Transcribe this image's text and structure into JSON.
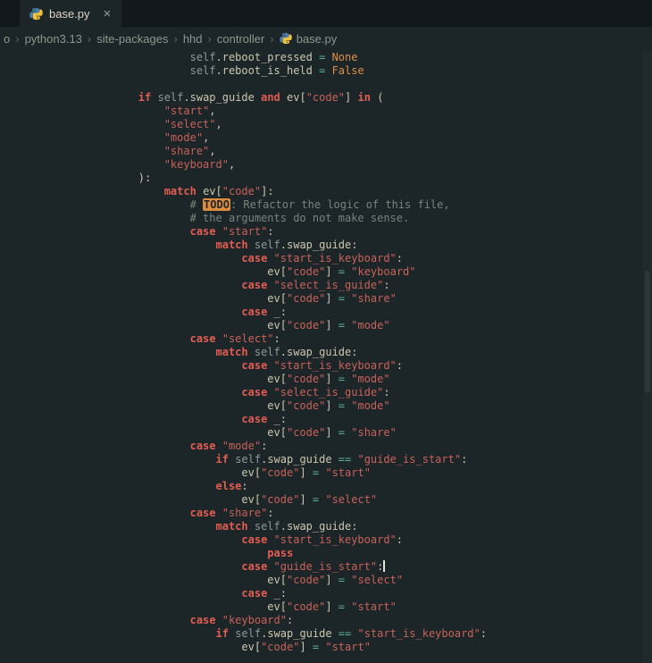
{
  "colors": {
    "bg": "#1c2527",
    "tabbar": "#12191c",
    "fg": "#ccc7af",
    "kw": "#e25d52",
    "str": "#c8625a",
    "op": "#5bb193",
    "cons": "#dd9046",
    "cmt": "#79837c",
    "slf": "#8b99a4",
    "todo_bg": "#de8d40",
    "todo_fg": "#1c2527",
    "bc": "#8d978f",
    "tab_fg": "#dcd6c6",
    "cursor": "#e0e4dd"
  },
  "tab": {
    "label": "base.py",
    "close_glyph": "×"
  },
  "breadcrumb": {
    "separator": "›",
    "items": [
      "o",
      "python3.13",
      "site-packages",
      "hhd",
      "controller",
      "base.py"
    ]
  },
  "editor": {
    "cursor_line": 38,
    "lines": [
      [
        [
          "v",
          "                "
        ],
        [
          "f",
          "self"
        ],
        [
          "v",
          ".reboot_pressed "
        ],
        [
          "o",
          "="
        ],
        [
          "v",
          " "
        ],
        [
          "c",
          "None"
        ]
      ],
      [
        [
          "v",
          "                "
        ],
        [
          "f",
          "self"
        ],
        [
          "v",
          ".reboot_is_held "
        ],
        [
          "o",
          "="
        ],
        [
          "v",
          " "
        ],
        [
          "c",
          "False"
        ]
      ],
      [],
      [
        [
          "v",
          "        "
        ],
        [
          "k",
          "if "
        ],
        [
          "f",
          "self"
        ],
        [
          "v",
          ".swap_guide "
        ],
        [
          "k",
          "and "
        ],
        [
          "v",
          "ev["
        ],
        [
          "s",
          "\"code\""
        ],
        [
          "v",
          "] "
        ],
        [
          "k",
          "in "
        ],
        [
          "v",
          "("
        ]
      ],
      [
        [
          "v",
          "            "
        ],
        [
          "s",
          "\"start\""
        ],
        [
          "v",
          ","
        ]
      ],
      [
        [
          "v",
          "            "
        ],
        [
          "s",
          "\"select\""
        ],
        [
          "v",
          ","
        ]
      ],
      [
        [
          "v",
          "            "
        ],
        [
          "s",
          "\"mode\""
        ],
        [
          "v",
          ","
        ]
      ],
      [
        [
          "v",
          "            "
        ],
        [
          "s",
          "\"share\""
        ],
        [
          "v",
          ","
        ]
      ],
      [
        [
          "v",
          "            "
        ],
        [
          "s",
          "\"keyboard\""
        ],
        [
          "v",
          ","
        ]
      ],
      [
        [
          "v",
          "        ):"
        ]
      ],
      [
        [
          "v",
          "            "
        ],
        [
          "k",
          "match "
        ],
        [
          "v",
          "ev["
        ],
        [
          "s",
          "\"code\""
        ],
        [
          "v",
          "]:"
        ]
      ],
      [
        [
          "v",
          "                "
        ],
        [
          "m",
          "# "
        ],
        [
          "t",
          "TODO"
        ],
        [
          "m",
          ": Refactor the logic of this file,"
        ]
      ],
      [
        [
          "v",
          "                "
        ],
        [
          "m",
          "# the arguments do not make sense."
        ]
      ],
      [
        [
          "v",
          "                "
        ],
        [
          "k",
          "case "
        ],
        [
          "s",
          "\"start\""
        ],
        [
          "v",
          ":"
        ]
      ],
      [
        [
          "v",
          "                    "
        ],
        [
          "k",
          "match "
        ],
        [
          "f",
          "self"
        ],
        [
          "v",
          ".swap_guide:"
        ]
      ],
      [
        [
          "v",
          "                        "
        ],
        [
          "k",
          "case "
        ],
        [
          "s",
          "\"start_is_keyboard\""
        ],
        [
          "v",
          ":"
        ]
      ],
      [
        [
          "v",
          "                            ev["
        ],
        [
          "s",
          "\"code\""
        ],
        [
          "v",
          "] "
        ],
        [
          "o",
          "="
        ],
        [
          "v",
          " "
        ],
        [
          "s",
          "\"keyboard\""
        ]
      ],
      [
        [
          "v",
          "                        "
        ],
        [
          "k",
          "case "
        ],
        [
          "s",
          "\"select_is_guide\""
        ],
        [
          "v",
          ":"
        ]
      ],
      [
        [
          "v",
          "                            ev["
        ],
        [
          "s",
          "\"code\""
        ],
        [
          "v",
          "] "
        ],
        [
          "o",
          "="
        ],
        [
          "v",
          " "
        ],
        [
          "s",
          "\"share\""
        ]
      ],
      [
        [
          "v",
          "                        "
        ],
        [
          "k",
          "case "
        ],
        [
          "v",
          "_:"
        ]
      ],
      [
        [
          "v",
          "                            ev["
        ],
        [
          "s",
          "\"code\""
        ],
        [
          "v",
          "] "
        ],
        [
          "o",
          "="
        ],
        [
          "v",
          " "
        ],
        [
          "s",
          "\"mode\""
        ]
      ],
      [
        [
          "v",
          "                "
        ],
        [
          "k",
          "case "
        ],
        [
          "s",
          "\"select\""
        ],
        [
          "v",
          ":"
        ]
      ],
      [
        [
          "v",
          "                    "
        ],
        [
          "k",
          "match "
        ],
        [
          "f",
          "self"
        ],
        [
          "v",
          ".swap_guide:"
        ]
      ],
      [
        [
          "v",
          "                        "
        ],
        [
          "k",
          "case "
        ],
        [
          "s",
          "\"start_is_keyboard\""
        ],
        [
          "v",
          ":"
        ]
      ],
      [
        [
          "v",
          "                            ev["
        ],
        [
          "s",
          "\"code\""
        ],
        [
          "v",
          "] "
        ],
        [
          "o",
          "="
        ],
        [
          "v",
          " "
        ],
        [
          "s",
          "\"mode\""
        ]
      ],
      [
        [
          "v",
          "                        "
        ],
        [
          "k",
          "case "
        ],
        [
          "s",
          "\"select_is_guide\""
        ],
        [
          "v",
          ":"
        ]
      ],
      [
        [
          "v",
          "                            ev["
        ],
        [
          "s",
          "\"code\""
        ],
        [
          "v",
          "] "
        ],
        [
          "o",
          "="
        ],
        [
          "v",
          " "
        ],
        [
          "s",
          "\"mode\""
        ]
      ],
      [
        [
          "v",
          "                        "
        ],
        [
          "k",
          "case "
        ],
        [
          "v",
          "_:"
        ]
      ],
      [
        [
          "v",
          "                            ev["
        ],
        [
          "s",
          "\"code\""
        ],
        [
          "v",
          "] "
        ],
        [
          "o",
          "="
        ],
        [
          "v",
          " "
        ],
        [
          "s",
          "\"share\""
        ]
      ],
      [
        [
          "v",
          "                "
        ],
        [
          "k",
          "case "
        ],
        [
          "s",
          "\"mode\""
        ],
        [
          "v",
          ":"
        ]
      ],
      [
        [
          "v",
          "                    "
        ],
        [
          "k",
          "if "
        ],
        [
          "f",
          "self"
        ],
        [
          "v",
          ".swap_guide "
        ],
        [
          "o",
          "=="
        ],
        [
          "v",
          " "
        ],
        [
          "s",
          "\"guide_is_start\""
        ],
        [
          "v",
          ":"
        ]
      ],
      [
        [
          "v",
          "                        ev["
        ],
        [
          "s",
          "\"code\""
        ],
        [
          "v",
          "] "
        ],
        [
          "o",
          "="
        ],
        [
          "v",
          " "
        ],
        [
          "s",
          "\"start\""
        ]
      ],
      [
        [
          "v",
          "                    "
        ],
        [
          "k",
          "else"
        ],
        [
          "v",
          ":"
        ]
      ],
      [
        [
          "v",
          "                        ev["
        ],
        [
          "s",
          "\"code\""
        ],
        [
          "v",
          "] "
        ],
        [
          "o",
          "="
        ],
        [
          "v",
          " "
        ],
        [
          "s",
          "\"select\""
        ]
      ],
      [
        [
          "v",
          "                "
        ],
        [
          "k",
          "case "
        ],
        [
          "s",
          "\"share\""
        ],
        [
          "v",
          ":"
        ]
      ],
      [
        [
          "v",
          "                    "
        ],
        [
          "k",
          "match "
        ],
        [
          "f",
          "self"
        ],
        [
          "v",
          ".swap_guide:"
        ]
      ],
      [
        [
          "v",
          "                        "
        ],
        [
          "k",
          "case "
        ],
        [
          "s",
          "\"start_is_keyboard\""
        ],
        [
          "v",
          ":"
        ]
      ],
      [
        [
          "v",
          "                            "
        ],
        [
          "k",
          "pass"
        ]
      ],
      [
        [
          "v",
          "                        "
        ],
        [
          "k",
          "case "
        ],
        [
          "s",
          "\"guide_is_start\""
        ],
        [
          "v",
          ":"
        ]
      ],
      [
        [
          "v",
          "                            ev["
        ],
        [
          "s",
          "\"code\""
        ],
        [
          "v",
          "] "
        ],
        [
          "o",
          "="
        ],
        [
          "v",
          " "
        ],
        [
          "s",
          "\"select\""
        ]
      ],
      [
        [
          "v",
          "                        "
        ],
        [
          "k",
          "case "
        ],
        [
          "v",
          "_:"
        ]
      ],
      [
        [
          "v",
          "                            ev["
        ],
        [
          "s",
          "\"code\""
        ],
        [
          "v",
          "] "
        ],
        [
          "o",
          "="
        ],
        [
          "v",
          " "
        ],
        [
          "s",
          "\"start\""
        ]
      ],
      [
        [
          "v",
          "                "
        ],
        [
          "k",
          "case "
        ],
        [
          "s",
          "\"keyboard\""
        ],
        [
          "v",
          ":"
        ]
      ],
      [
        [
          "v",
          "                    "
        ],
        [
          "k",
          "if "
        ],
        [
          "f",
          "self"
        ],
        [
          "v",
          ".swap_guide "
        ],
        [
          "o",
          "=="
        ],
        [
          "v",
          " "
        ],
        [
          "s",
          "\"start_is_keyboard\""
        ],
        [
          "v",
          ":"
        ]
      ],
      [
        [
          "v",
          "                        ev["
        ],
        [
          "s",
          "\"code\""
        ],
        [
          "v",
          "] "
        ],
        [
          "o",
          "="
        ],
        [
          "v",
          " "
        ],
        [
          "s",
          "\"start\""
        ]
      ]
    ]
  }
}
